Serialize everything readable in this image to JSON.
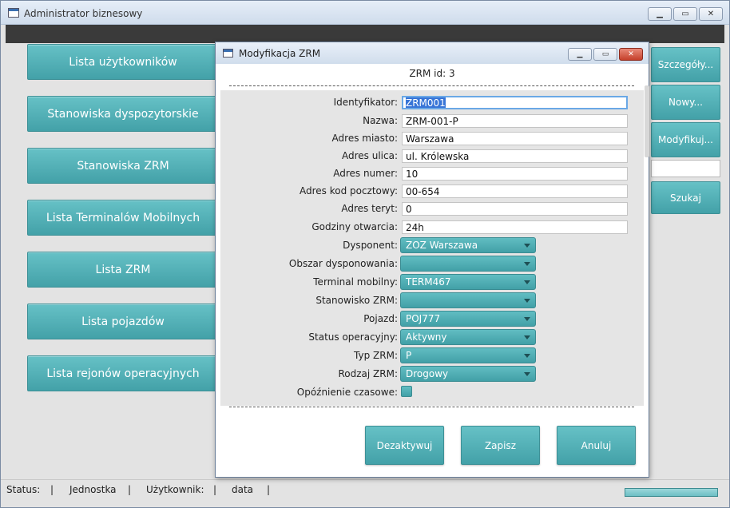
{
  "window": {
    "title": "Administrator biznesowy"
  },
  "nav": [
    {
      "label": "Lista użytkowników"
    },
    {
      "label": "Stanowiska dyspozytorskie"
    },
    {
      "label": "Stanowiska ZRM"
    },
    {
      "label": "Lista Terminalów Mobilnych"
    },
    {
      "label": "Lista ZRM"
    },
    {
      "label": "Lista pojazdów"
    },
    {
      "label": "Lista rejonów operacyjnych"
    }
  ],
  "right_panel": {
    "details_label": "Szczegóły...",
    "new_label": "Nowy...",
    "modify_label": "Modyfikuj...",
    "search_value": "",
    "search_label": "Szukaj"
  },
  "status_bar": {
    "status": "Status:",
    "unit": "Jednostka",
    "user": "Użytkownik:",
    "date": "data",
    "sep": "|"
  },
  "dialog": {
    "title": "Modyfikacja ZRM",
    "zrm_id": "ZRM id: 3",
    "fields": {
      "identyfikator": {
        "label": "Identyfikator:",
        "value": "ZRM001"
      },
      "nazwa": {
        "label": "Nazwa:",
        "value": "ZRM-001-P"
      },
      "adres_miasto": {
        "label": "Adres miasto:",
        "value": "Warszawa"
      },
      "adres_ulica": {
        "label": "Adres ulica:",
        "value": "ul. Królewska"
      },
      "adres_numer": {
        "label": "Adres numer:",
        "value": "10"
      },
      "adres_kod": {
        "label": "Adres kod pocztowy:",
        "value": "00-654"
      },
      "adres_teryt": {
        "label": "Adres teryt:",
        "value": "0"
      },
      "godziny": {
        "label": "Godziny otwarcia:",
        "value": "24h"
      }
    },
    "combos": {
      "dysponent": {
        "label": "Dysponent:",
        "value": "ZOZ Warszawa"
      },
      "obszar": {
        "label": "Obszar dysponowania:",
        "value": ""
      },
      "terminal": {
        "label": "Terminal mobilny:",
        "value": "TERM467"
      },
      "stanowisko": {
        "label": "Stanowisko ZRM:",
        "value": ""
      },
      "pojazd": {
        "label": "Pojazd:",
        "value": "POJ777"
      },
      "status": {
        "label": "Status operacyjny:",
        "value": "Aktywny"
      },
      "typ": {
        "label": "Typ ZRM:",
        "value": "P"
      },
      "rodzaj": {
        "label": "Rodzaj ZRM:",
        "value": "Drogowy"
      }
    },
    "delay": {
      "label": "Opóźnienie czasowe:",
      "checked": false
    },
    "buttons": {
      "deactivate": "Dezaktywuj",
      "save": "Zapisz",
      "cancel": "Anuluj"
    }
  },
  "colors": {
    "accent": "#4fafb5",
    "focus": "#3875d7"
  }
}
